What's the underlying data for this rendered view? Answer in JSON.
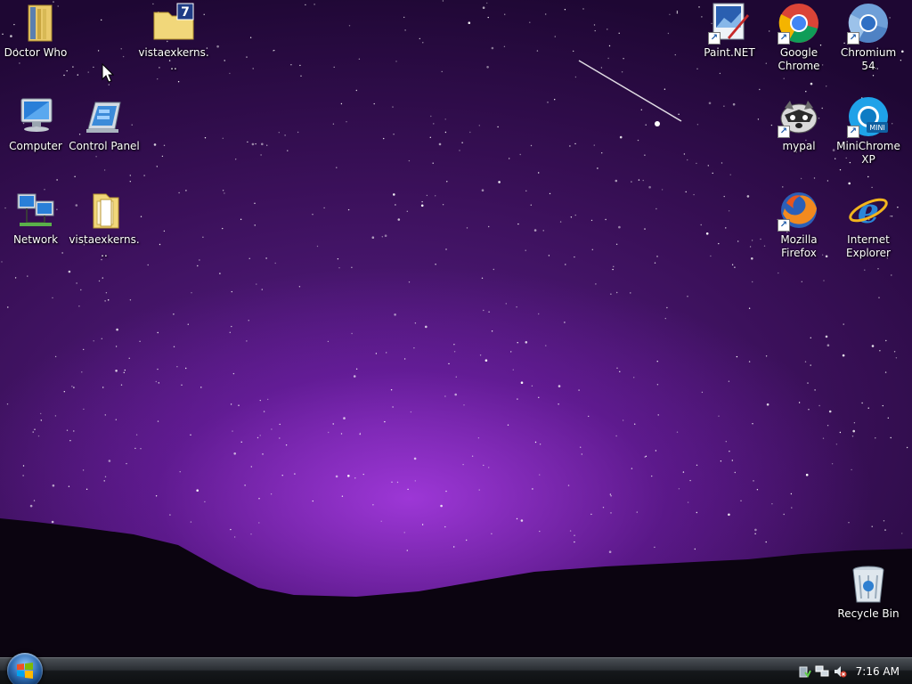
{
  "desktop_icons": {
    "doctor_who": {
      "label": "Doctor Who",
      "icon": "folder-icon"
    },
    "vista_7": {
      "label": "vistaexkerns...",
      "icon": "folder-7-icon"
    },
    "computer": {
      "label": "Computer",
      "icon": "computer-icon"
    },
    "control_panel": {
      "label": "Control Panel",
      "icon": "control-panel-icon"
    },
    "network": {
      "label": "Network",
      "icon": "network-icon"
    },
    "vista_folder": {
      "label": "vistaexkerns...",
      "icon": "folder-icon"
    },
    "paint_net": {
      "label": "Paint.NET",
      "icon": "paint-net-icon"
    },
    "google_chrome": {
      "label": "Google Chrome",
      "icon": "chrome-icon"
    },
    "chromium": {
      "label": "Chromium 54",
      "icon": "chromium-icon"
    },
    "mypal": {
      "label": "mypal",
      "icon": "mypal-icon"
    },
    "minichrome": {
      "label": "MiniChrome XP",
      "icon": "minichrome-icon"
    },
    "firefox": {
      "label": "Mozilla Firefox",
      "icon": "firefox-icon"
    },
    "ie": {
      "label": "Internet Explorer",
      "icon": "internet-explorer-icon"
    },
    "recycle_bin": {
      "label": "Recycle Bin",
      "icon": "recycle-bin-icon"
    }
  },
  "taskbar": {
    "start_icon": "windows-logo-icon",
    "tray_icons": [
      "safely-remove-icon",
      "network-status-icon",
      "volume-muted-icon"
    ],
    "clock": "7:16 AM"
  },
  "colors": {
    "sky_top": "#1e0733",
    "sky_glow": "#aa3ce6",
    "taskbar": "#15181b"
  }
}
